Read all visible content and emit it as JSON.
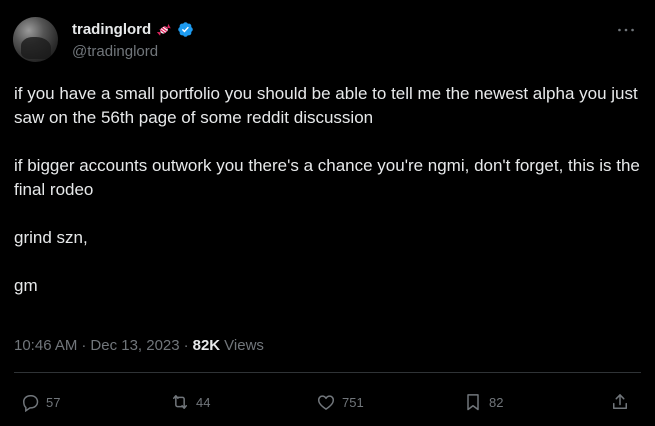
{
  "author": {
    "display_name": "tradinglord",
    "handle": "@tradinglord",
    "badge_icon": "candy-icon",
    "verified_icon": "verified-badge-icon",
    "verified_color": "#1d9bf0"
  },
  "tweet": {
    "paragraphs": [
      "if you have a small portfolio you should be able to tell me the newest alpha you just saw on the 56th page of some reddit discussion",
      "if bigger accounts outwork you there's a chance you're ngmi, don't forget, this is the final rodeo",
      "grind szn,",
      "gm"
    ],
    "time": "10:46 AM",
    "separator": "·",
    "date": "Dec 13, 2023",
    "views_count": "82K",
    "views_label": "Views"
  },
  "actions": {
    "replies": "57",
    "reposts": "44",
    "likes": "751",
    "bookmarks": "82"
  },
  "colors": {
    "background": "#000000",
    "text_primary": "#e7e9ea",
    "text_secondary": "#71767b",
    "divider": "#2f3336"
  }
}
